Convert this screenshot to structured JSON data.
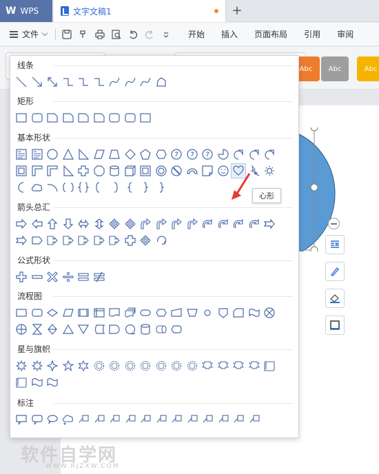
{
  "titlebar": {
    "app_label": "WPS",
    "doc_tab_label": "文字文稿1",
    "add_tab_label": "+"
  },
  "menubar": {
    "file_label": "文件",
    "tabs": [
      "开始",
      "插入",
      "页面布局",
      "引用",
      "审阅"
    ]
  },
  "ribbon": {
    "styles": [
      {
        "label": "Abc",
        "color": "#ee7d2b"
      },
      {
        "label": "Abc",
        "color": "#9e9e9e"
      },
      {
        "label": "Abc",
        "color": "#f6b400"
      }
    ]
  },
  "shapes_panel": {
    "sections": [
      {
        "title": "线条",
        "rows": [
          10
        ]
      },
      {
        "title": "矩形",
        "rows": [
          9
        ]
      },
      {
        "title": "基本形状",
        "rows": [
          17,
          17,
          10
        ]
      },
      {
        "title": "箭头总汇",
        "rows": [
          17,
          10
        ]
      },
      {
        "title": "公式形状",
        "rows": [
          6
        ]
      },
      {
        "title": "流程图",
        "rows": [
          17,
          11
        ]
      },
      {
        "title": "星与旗帜",
        "rows": [
          17,
          3
        ]
      },
      {
        "title": "标注",
        "rows": [
          16
        ]
      }
    ],
    "tooltip": "心形",
    "hovered_shape": "heart"
  },
  "watermark": {
    "text": "软件自学网",
    "url": "WWW.RJZXW.COM"
  },
  "colors": {
    "accent": "#2f6bd8",
    "shape_stroke": "#4a6aa8",
    "ellipse_fill": "#5b9bd5",
    "wps_tab": "#5873a8",
    "tooltip_arrow": "#e53935"
  }
}
